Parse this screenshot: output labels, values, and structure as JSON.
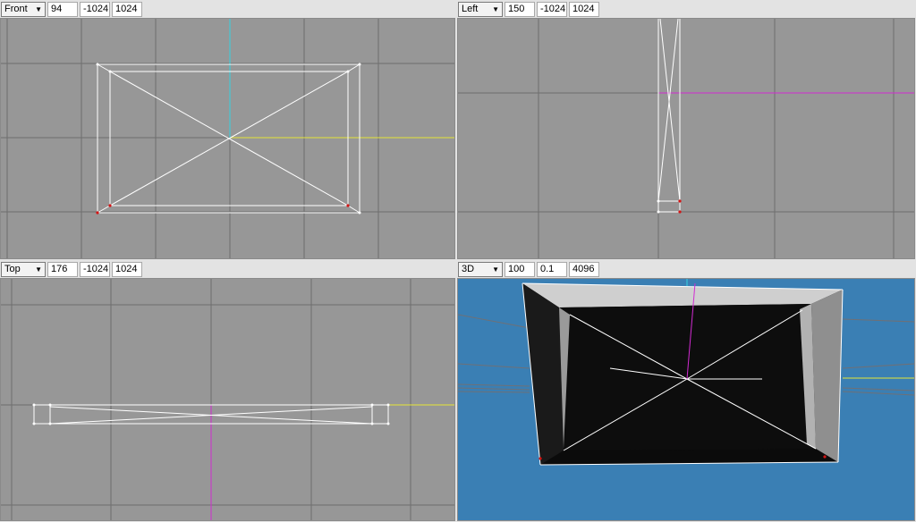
{
  "viewports": [
    {
      "view": "Front",
      "v1": "94",
      "v2": "-1024",
      "v3": "1024"
    },
    {
      "view": "Left",
      "v1": "150",
      "v2": "-1024",
      "v3": "1024"
    },
    {
      "view": "Top",
      "v1": "176",
      "v2": "-1024",
      "v3": "1024"
    },
    {
      "view": "3D",
      "v1": "100",
      "v2": "0.1",
      "v3": "4096"
    }
  ],
  "colors": {
    "grid_bg": "#979797",
    "grid_line": "#6e6e6e",
    "sky": "#3a7fb4",
    "wire": "#ffffff",
    "axis_yellow": "#e4e437",
    "axis_magenta": "#d22bd2",
    "axis_cyan": "#35d2e0",
    "vertex_red": "#d31414"
  }
}
